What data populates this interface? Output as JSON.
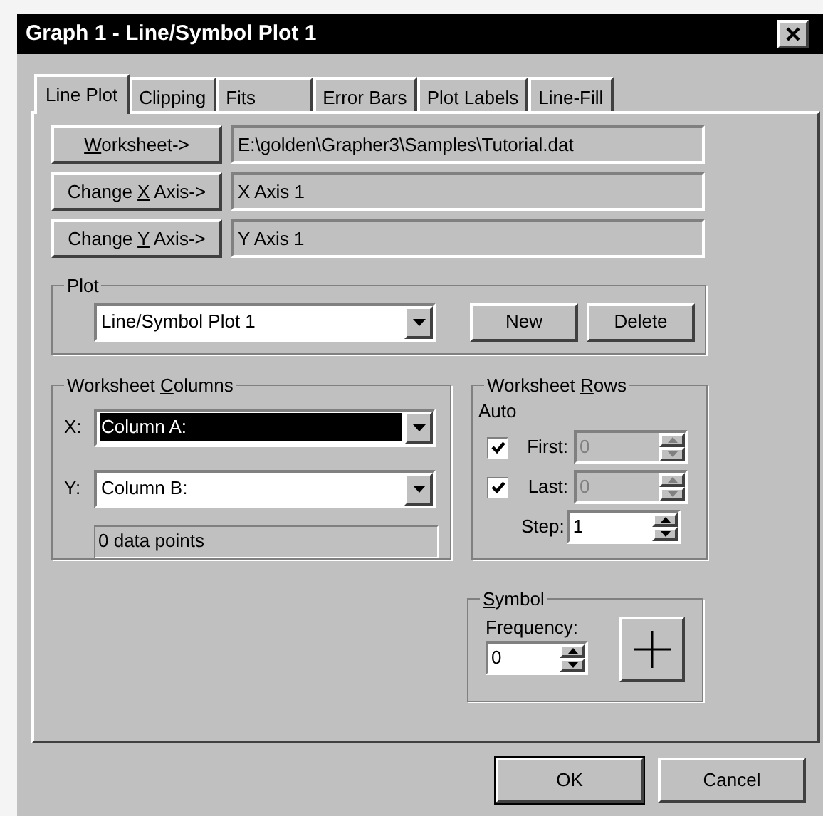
{
  "window": {
    "title": "Graph 1 - Line/Symbol Plot 1"
  },
  "tabs": [
    {
      "label": "Line Plot",
      "selected": true
    },
    {
      "label": "Clipping",
      "selected": false
    },
    {
      "label": "Fits",
      "selected": false
    },
    {
      "label": "Error Bars",
      "selected": false
    },
    {
      "label": "Plot Labels",
      "selected": false
    },
    {
      "label": "Line-Fill",
      "selected": false
    }
  ],
  "source_rows": [
    {
      "button": {
        "key": "W",
        "after": "orksheet->"
      },
      "value": "E:\\golden\\Grapher3\\Samples\\Tutorial.dat"
    },
    {
      "button": {
        "before": "Change ",
        "key": "X",
        "after": " Axis->"
      },
      "value": "X Axis 1"
    },
    {
      "button": {
        "before": "Change ",
        "key": "Y",
        "after": " Axis->"
      },
      "value": "Y Axis 1"
    }
  ],
  "plot": {
    "title": "Plot",
    "value": "Line/Symbol Plot 1",
    "buttons": [
      "New",
      "Delete"
    ]
  },
  "worksheet_columns": {
    "title": {
      "before": "Worksheet ",
      "key": "C",
      "after": "olumns"
    },
    "x": {
      "label": "X:",
      "value": "Column A:",
      "focused": true
    },
    "y": {
      "label": "Y:",
      "value": "Column B:",
      "focused": false
    },
    "info": "0 data points"
  },
  "worksheet_rows": {
    "title": {
      "before": "Worksheet ",
      "key": "R",
      "after": "ows"
    },
    "auto_label": "Auto",
    "first": {
      "label": "First:",
      "checked": true,
      "value": "0",
      "disabled": true
    },
    "last": {
      "label": "Last:",
      "checked": true,
      "value": "0",
      "disabled": true
    },
    "step": {
      "label": "Step:",
      "value": "1",
      "disabled": false
    }
  },
  "symbol": {
    "title": {
      "key": "S",
      "after": "ymbol"
    },
    "frequency_label": "Frequency:",
    "frequency": "0"
  },
  "buttons": [
    "OK",
    "Cancel"
  ]
}
